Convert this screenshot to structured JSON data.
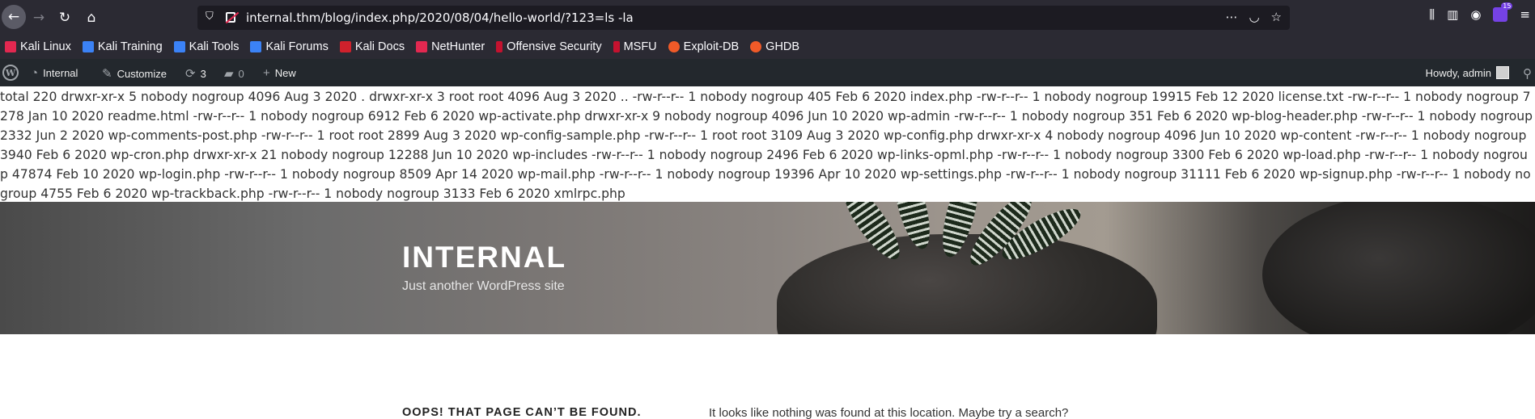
{
  "browser": {
    "url": "internal.thm/blog/index.php/2020/08/04/hello-world/?123=ls -la",
    "extension_badge": "15",
    "icons": [
      "back-arrow-icon",
      "forward-arrow-icon",
      "reload-icon",
      "home-icon",
      "shield-icon",
      "lock-insecure-icon",
      "more-icon",
      "pocket-icon",
      "star-icon",
      "library-icon",
      "sidebar-icon",
      "account-icon",
      "extension-icon",
      "menu-icon"
    ]
  },
  "bookmarks": [
    {
      "label": "Kali Linux",
      "color": "#e22850"
    },
    {
      "label": "Kali Training",
      "color": "#3b82f6"
    },
    {
      "label": "Kali Tools",
      "color": "#3b82f6"
    },
    {
      "label": "Kali Forums",
      "color": "#3b82f6"
    },
    {
      "label": "Kali Docs",
      "color": "#d0212c"
    },
    {
      "label": "NetHunter",
      "color": "#e22850"
    },
    {
      "label": "Offensive Security",
      "color": "#c4122f"
    },
    {
      "label": "MSFU",
      "color": "#c4122f"
    },
    {
      "label": "Exploit-DB",
      "color": "#f05a28"
    },
    {
      "label": "GHDB",
      "color": "#f05a28"
    }
  ],
  "adminbar": {
    "site_name": "Internal",
    "customize": "Customize",
    "updates_count": "3",
    "comments_count": "0",
    "new_label": "New",
    "howdy": "Howdy, admin"
  },
  "command_output": "total 220 drwxr-xr-x 5 nobody nogroup 4096 Aug 3 2020 . drwxr-xr-x 3 root root 4096 Aug 3 2020 .. -rw-r--r-- 1 nobody nogroup 405 Feb 6 2020 index.php -rw-r--r-- 1 nobody nogroup 19915 Feb 12 2020 license.txt -rw-r--r-- 1 nobody nogroup 7278 Jan 10 2020 readme.html -rw-r--r-- 1 nobody nogroup 6912 Feb 6 2020 wp-activate.php drwxr-xr-x 9 nobody nogroup 4096 Jun 10 2020 wp-admin -rw-r--r-- 1 nobody nogroup 351 Feb 6 2020 wp-blog-header.php -rw-r--r-- 1 nobody nogroup 2332 Jun 2 2020 wp-comments-post.php -rw-r--r-- 1 root root 2899 Aug 3 2020 wp-config-sample.php -rw-r--r-- 1 root root 3109 Aug 3 2020 wp-config.php drwxr-xr-x 4 nobody nogroup 4096 Jun 10 2020 wp-content -rw-r--r-- 1 nobody nogroup 3940 Feb 6 2020 wp-cron.php drwxr-xr-x 21 nobody nogroup 12288 Jun 10 2020 wp-includes -rw-r--r-- 1 nobody nogroup 2496 Feb 6 2020 wp-links-opml.php -rw-r--r-- 1 nobody nogroup 3300 Feb 6 2020 wp-load.php -rw-r--r-- 1 nobody nogroup 47874 Feb 10 2020 wp-login.php -rw-r--r-- 1 nobody nogroup 8509 Apr 14 2020 wp-mail.php -rw-r--r-- 1 nobody nogroup 19396 Apr 10 2020 wp-settings.php -rw-r--r-- 1 nobody nogroup 31111 Feb 6 2020 wp-signup.php -rw-r--r-- 1 nobody nogroup 4755 Feb 6 2020 wp-trackback.php -rw-r--r-- 1 nobody nogroup 3133 Feb 6 2020 xmlrpc.php",
  "header": {
    "site_title": "INTERNAL",
    "site_description": "Just another WordPress site"
  },
  "content": {
    "heading": "OOPS! THAT PAGE CAN’T BE FOUND.",
    "message": "It looks like nothing was found at this location. Maybe try a search?"
  }
}
